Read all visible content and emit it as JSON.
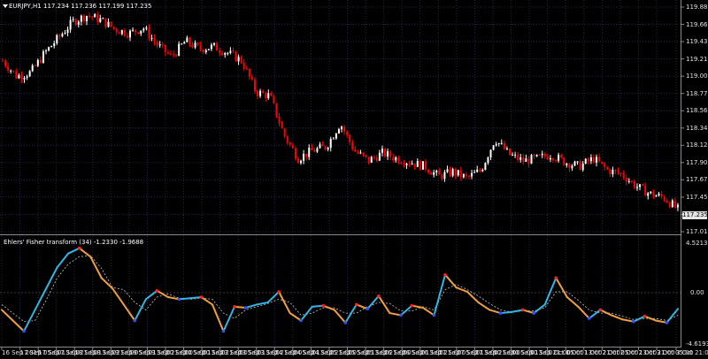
{
  "main_pane": {
    "title": "EURJPY,H1 117.234 117.236 117.199 117.235",
    "current_price": "117.235",
    "y_labels": [
      "119.885",
      "119.660",
      "119.435",
      "119.210",
      "119.000",
      "118.775",
      "118.560",
      "118.340",
      "118.120",
      "117.900",
      "117.675",
      "117.455",
      "117.235",
      "117.015"
    ]
  },
  "indicator_pane": {
    "title": "Ehlers' Fisher transform (34) -1.2330 -1.9688",
    "y_labels": [
      "4.5213",
      "0.00",
      "-4.6193"
    ]
  },
  "x_labels": [
    "16 Sep 2019",
    "17 Sep 05:00",
    "17 Sep 13:00",
    "17 Sep 21:00",
    "18 Sep 13:00",
    "18 Sep 21:00",
    "19 Sep 05:00",
    "19 Sep 13:00",
    "19 Sep 21:00",
    "20 Sep 05:00",
    "20 Sep 13:00",
    "20 Sep 21:00",
    "23 Sep 05:00",
    "23 Sep 13:00",
    "23 Sep 21:00",
    "24 Sep 05:00",
    "24 Sep 13:00",
    "24 Sep 21:00",
    "25 Sep 05:00",
    "25 Sep 13:00",
    "25 Sep 21:00",
    "26 Sep 05:00",
    "26 Sep 13:00",
    "26 Sep 21:00",
    "27 Sep 05:00",
    "27 Sep 13:00",
    "27 Sep 21:00",
    "30 Sep 05:00",
    "30 Sep 13:00",
    "30 Sep 21:00",
    "1 Oct 05:00",
    "1 Oct 13:00",
    "1 Oct 21:00",
    "2 Oct 05:00",
    "2 Oct 13:00",
    "2 Oct 21:00",
    "3 Oct 05:00",
    "3 Oct 21:00"
  ],
  "colors": {
    "bull": "#ffffff",
    "bear": "#ff0000",
    "grid": "#1e2a4a",
    "fisher_up": "#33b5e5",
    "fisher_down": "#f0a040",
    "trigger": "#c8c8c8",
    "dot_red": "#ff2020",
    "dot_blue": "#3050ff"
  },
  "chart_data": [
    {
      "type": "candlestick",
      "title": "EURJPY,H1",
      "ylim": [
        117.015,
        119.885
      ],
      "close_path": [
        119.2,
        119.0,
        119.05,
        119.3,
        119.5,
        119.7,
        119.78,
        119.72,
        119.6,
        119.55,
        119.62,
        119.4,
        119.25,
        119.45,
        119.35,
        119.38,
        119.3,
        119.2,
        118.8,
        118.75,
        118.25,
        117.95,
        118.05,
        118.1,
        118.4,
        118.05,
        117.92,
        118.02,
        117.95,
        117.9,
        117.85,
        117.72,
        117.78,
        117.7,
        117.8,
        118.2,
        118.0,
        117.92,
        117.95,
        118.0,
        117.9,
        117.85,
        117.95,
        117.8,
        117.75,
        117.6,
        117.5,
        117.45,
        117.3
      ]
    },
    {
      "type": "line",
      "title": "Ehlers' Fisher transform (34)",
      "ylim": [
        -4.6193,
        4.5213
      ],
      "fisher": [
        -1.5,
        -2.5,
        -3.5,
        -1.5,
        0.5,
        2.5,
        3.8,
        4.3,
        3.5,
        1.5,
        0.5,
        -1.0,
        -2.5,
        -0.5,
        0.3,
        -0.3,
        -0.5,
        -0.4,
        -0.3,
        -1.0,
        -3.5,
        -1.2,
        -1.3,
        -1.0,
        -0.8,
        0.2,
        -1.8,
        -2.5,
        -1.2,
        -1.1,
        -1.5,
        -2.7,
        -1.0,
        -1.4,
        -0.2,
        -1.8,
        -2.0,
        -1.1,
        -1.3,
        -2.0,
        1.8,
        0.6,
        0.2,
        -0.8,
        -1.5,
        -1.8,
        -1.7,
        -1.5,
        -1.8,
        -1.0,
        1.5,
        -0.3,
        -1.2,
        -2.3,
        -1.5,
        -2.0,
        -2.4,
        -2.6,
        -2.1,
        -2.5,
        -2.7,
        -1.4
      ],
      "trigger": [
        -1.0,
        -1.8,
        -2.6,
        -2.5,
        -0.6,
        1.5,
        2.8,
        3.5,
        3.6,
        2.4,
        0.6,
        0.4,
        -0.8,
        -1.5,
        -0.3,
        0.0,
        -0.4,
        -0.5,
        -0.4,
        -0.5,
        -1.8,
        -2.3,
        -1.5,
        -1.2,
        -0.9,
        -0.5,
        -0.8,
        -2.0,
        -1.8,
        -1.3,
        -1.3,
        -1.8,
        -1.8,
        -1.2,
        -0.8,
        -0.9,
        -1.6,
        -1.6,
        -1.2,
        -1.5,
        0.4,
        0.9,
        0.4,
        -0.2,
        -0.9,
        -1.5,
        -1.7,
        -1.6,
        -1.6,
        -1.3,
        0.2,
        0.2,
        -0.6,
        -1.5,
        -1.8,
        -1.8,
        -2.1,
        -2.4,
        -2.3,
        -2.3,
        -2.5,
        -2.0
      ]
    }
  ]
}
